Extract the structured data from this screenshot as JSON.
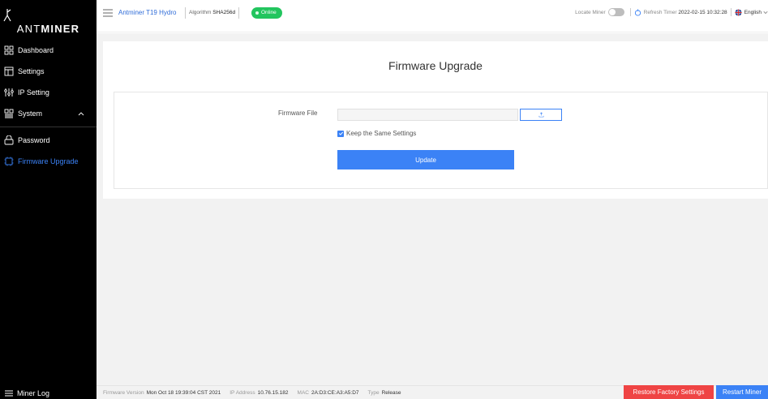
{
  "caption": "Firmware Upgrade",
  "brand": {
    "prefix": "ANT",
    "suffix": "MINER"
  },
  "sidebar": {
    "items": [
      {
        "label": "Dashboard",
        "icon": "dashboard-icon"
      },
      {
        "label": "Settings",
        "icon": "settings-icon"
      },
      {
        "label": "IP Setting",
        "icon": "ip-setting-icon"
      },
      {
        "label": "System",
        "icon": "system-icon"
      },
      {
        "label": "Password",
        "icon": "password-icon"
      },
      {
        "label": "Firmware Upgrade",
        "icon": "firmware-icon"
      }
    ],
    "footer_label": "Miner Log"
  },
  "header": {
    "model": "Antminer T19 Hydro",
    "algorithm_label": "Algorithm",
    "algorithm_value": "SHA256d",
    "status": "Online",
    "locate_label": "Locate Miner",
    "refresh_label": "Refresh Timer",
    "refresh_value": "2022-02-15 10:32:28",
    "language": "English"
  },
  "main": {
    "title": "Firmware Upgrade",
    "file_label": "Firmware File",
    "keep_label": "Keep the Same Settings",
    "update_label": "Update"
  },
  "footer": {
    "firmware_label": "Firmware Version",
    "firmware_value": "Mon Oct 18 19:39:04 CST 2021",
    "ip_label": "IP Address",
    "ip_value": "10.76.15.182",
    "mac_label": "MAC",
    "mac_value": "2A:D3:CE:A3:A5:D7",
    "type_label": "Type",
    "type_value": "Release",
    "restore_label": "Restore Factory Settings",
    "restart_label": "Restart Miner"
  },
  "colors": {
    "accent": "#3b82f6",
    "online": "#22c55e",
    "danger": "#ef4444",
    "sidebar": "#000000"
  }
}
